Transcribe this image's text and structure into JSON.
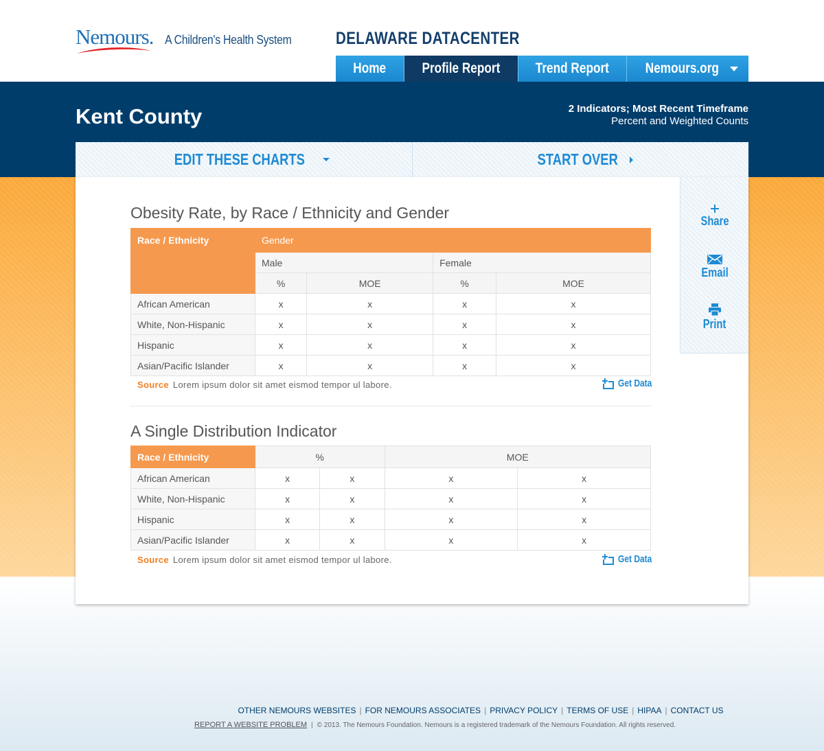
{
  "header": {
    "logo_text": "Nemours.",
    "tagline": "A Children's Health System",
    "site_title": "DELAWARE DATACENTER",
    "nav": [
      {
        "label": "Home",
        "active": false
      },
      {
        "label": "Profile Report",
        "active": true
      },
      {
        "label": "Trend Report",
        "active": false
      },
      {
        "label": "Nemours.org",
        "active": false,
        "dropdown": true
      }
    ]
  },
  "page": {
    "county": "Kent County",
    "meta_line1": "2 Indicators; Most Recent Timeframe",
    "meta_line2": "Percent and Weighted Counts"
  },
  "actions": {
    "edit_label": "EDIT THESE CHARTS",
    "start_over_label": "START OVER"
  },
  "sidebar": {
    "share": "Share",
    "email": "Email",
    "print": "Print"
  },
  "table1": {
    "title": "Obesity Rate, by Race / Ethnicity and Gender",
    "row_header": "Race / Ethnicity",
    "group_header": "Gender",
    "subgroups": [
      "Male",
      "Female"
    ],
    "columns": [
      "%",
      "MOE",
      "%",
      "MOE"
    ],
    "rows": [
      {
        "label": "African American",
        "values": [
          "x",
          "x",
          "x",
          "x"
        ]
      },
      {
        "label": "White, Non-Hispanic",
        "values": [
          "x",
          "x",
          "x",
          "x"
        ]
      },
      {
        "label": "Hispanic",
        "values": [
          "x",
          "x",
          "x",
          "x"
        ]
      },
      {
        "label": "Asian/Pacific Islander",
        "values": [
          "x",
          "x",
          "x",
          "x"
        ]
      }
    ],
    "source_label": "Source",
    "source_text": "Lorem ipsum dolor sit amet eismod tempor ul labore.",
    "get_data": "Get Data"
  },
  "table2": {
    "title": "A Single Distribution Indicator",
    "row_header": "Race / Ethnicity",
    "column_groups": [
      "%",
      "MOE"
    ],
    "rows": [
      {
        "label": "African American",
        "values": [
          "x",
          "x",
          "x",
          "x"
        ]
      },
      {
        "label": "White, Non-Hispanic",
        "values": [
          "x",
          "x",
          "x",
          "x"
        ]
      },
      {
        "label": "Hispanic",
        "values": [
          "x",
          "x",
          "x",
          "x"
        ]
      },
      {
        "label": "Asian/Pacific Islander",
        "values": [
          "x",
          "x",
          "x",
          "x"
        ]
      }
    ],
    "source_label": "Source",
    "source_text": "Lorem ipsum dolor sit amet eismod tempor ul labore.",
    "get_data": "Get Data"
  },
  "footer": {
    "links": [
      "OTHER NEMOURS WEBSITES",
      "FOR NEMOURS ASSOCIATES",
      "PRIVACY POLICY",
      "TERMS OF USE",
      "HIPAA",
      "CONTACT US"
    ],
    "report_problem": "REPORT A WEBSITE PROBLEM",
    "copyright": "© 2013. The Nemours Foundation. Nemours is a registered trademark of the Nemours Foundation. All rights reserved."
  },
  "colors": {
    "navy": "#003d6b",
    "accent_blue": "#1f8ad3",
    "orange": "#f5994e",
    "source_orange": "#f47f20"
  }
}
